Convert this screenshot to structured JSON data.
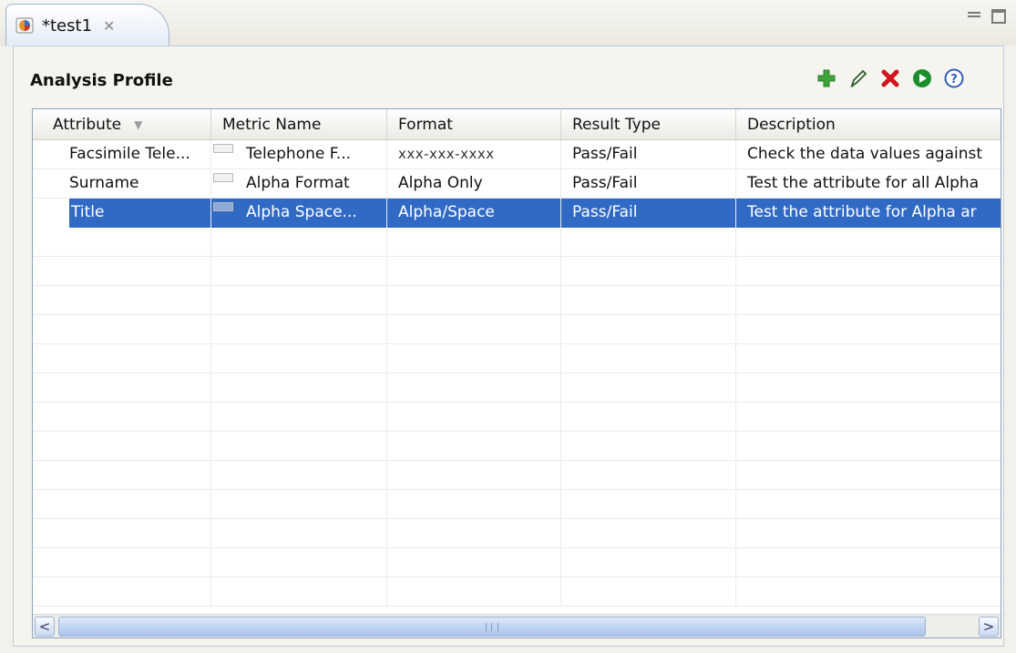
{
  "tab": {
    "title": "*test1",
    "close_glyph": "✕"
  },
  "section": {
    "title": "Analysis Profile"
  },
  "toolbar": [
    "add-icon",
    "edit-icon",
    "delete-icon",
    "run-icon",
    "help-icon"
  ],
  "table": {
    "columns": [
      "Attribute",
      "Metric Name",
      "Format",
      "Result Type",
      "Description"
    ],
    "sort_indicator": "▼",
    "rows": [
      {
        "attribute": "Facsimile Tele...",
        "metric": "Telephone F...",
        "format": "xxx-xxx-xxxx",
        "result_type": "Pass/Fail",
        "description": "Check the data values against"
      },
      {
        "attribute": "Surname",
        "metric": "Alpha Format",
        "format": "Alpha Only",
        "result_type": "Pass/Fail",
        "description": "Test the attribute for all Alpha"
      },
      {
        "attribute": "Title",
        "metric": "Alpha Space...",
        "format": "Alpha/Space",
        "result_type": "Pass/Fail",
        "description": "Test the attribute for Alpha ar"
      }
    ],
    "selected_row": 2
  },
  "scrollbar": {
    "left": "<",
    "right": ">"
  },
  "colors": {
    "selection": "#316ac5",
    "add": "#3fa53a",
    "delete": "#d0161e",
    "run": "#1b8f2e",
    "help": "#2e5db6"
  }
}
